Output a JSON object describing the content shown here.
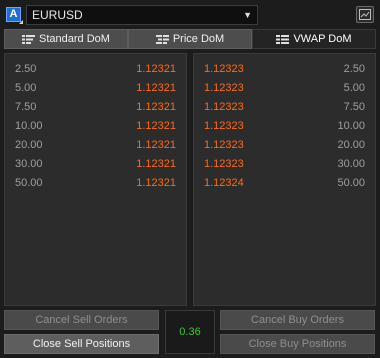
{
  "header": {
    "account_badge": "A",
    "symbol": "EURUSD",
    "chart_icon": "chart-icon"
  },
  "tabs": [
    {
      "label": "Standard DoM",
      "active": false,
      "icon": "standard-dom-icon"
    },
    {
      "label": "Price DoM",
      "active": false,
      "icon": "price-dom-icon"
    },
    {
      "label": "VWAP DoM",
      "active": true,
      "icon": "vwap-dom-icon"
    }
  ],
  "sell_book": {
    "rows": [
      {
        "volume": "2.50",
        "price": "1.12321"
      },
      {
        "volume": "5.00",
        "price": "1.12321"
      },
      {
        "volume": "7.50",
        "price": "1.12321"
      },
      {
        "volume": "10.00",
        "price": "1.12321"
      },
      {
        "volume": "20.00",
        "price": "1.12321"
      },
      {
        "volume": "30.00",
        "price": "1.12321"
      },
      {
        "volume": "50.00",
        "price": "1.12321"
      }
    ]
  },
  "buy_book": {
    "rows": [
      {
        "price": "1.12323",
        "volume": "2.50"
      },
      {
        "price": "1.12323",
        "volume": "5.00"
      },
      {
        "price": "1.12323",
        "volume": "7.50"
      },
      {
        "price": "1.12323",
        "volume": "10.00"
      },
      {
        "price": "1.12323",
        "volume": "20.00"
      },
      {
        "price": "1.12323",
        "volume": "30.00"
      },
      {
        "price": "1.12324",
        "volume": "50.00"
      }
    ]
  },
  "footer": {
    "cancel_sell_orders": "Cancel Sell Orders",
    "close_sell_positions": "Close Sell Positions",
    "spread": "0.36",
    "cancel_buy_orders": "Cancel Buy Orders",
    "close_buy_positions": "Close Buy Positions"
  },
  "colors": {
    "price": "#ff6a1a",
    "spread": "#38c438",
    "badge": "#1f6fd1"
  }
}
